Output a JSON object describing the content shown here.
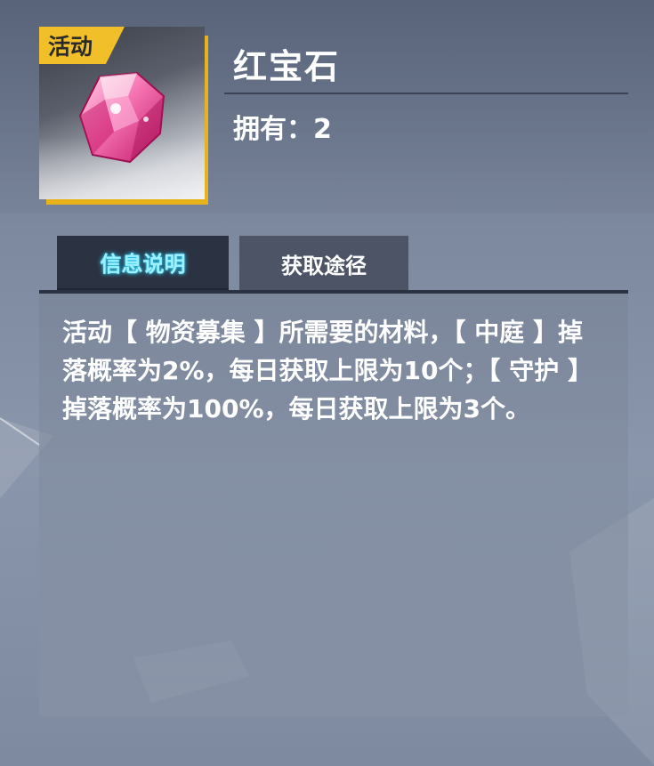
{
  "item": {
    "tag": "活动",
    "name": "红宝石",
    "owned_label": "拥有：",
    "owned_count": "2",
    "icon": "ruby-gem-icon"
  },
  "tabs": [
    {
      "label": "信息说明",
      "active": true
    },
    {
      "label": "获取途径",
      "active": false
    }
  ],
  "description": "活动【 物资募集 】所需要的材料，【 中庭 】掉落概率为2%，每日获取上限为10个；【 守护 】掉落概率为100%，每日获取上限为3个。",
  "colors": {
    "tag_gold": "#f0bf2a",
    "active_tab_text": "#9ef0ff",
    "gem_pink": "#f0589a"
  }
}
